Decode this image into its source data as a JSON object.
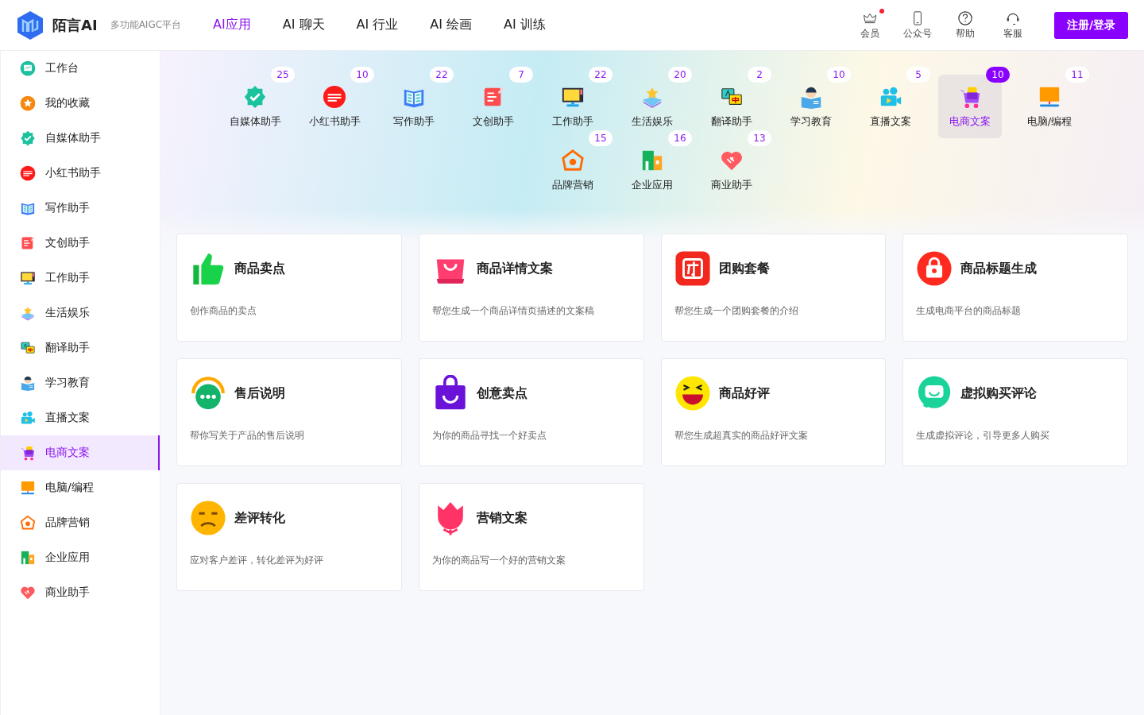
{
  "header": {
    "brand": "陌言AI",
    "tagline": "多功能AIGC平台",
    "nav": [
      {
        "label": "AI应用",
        "selected": true
      },
      {
        "label": "AI 聊天",
        "selected": false
      },
      {
        "label": "AI 行业",
        "selected": false
      },
      {
        "label": "AI 绘画",
        "selected": false
      },
      {
        "label": "AI 训练",
        "selected": false
      }
    ],
    "tools": [
      {
        "kind": "crown",
        "label": "会员",
        "dot": true
      },
      {
        "kind": "phone",
        "label": "公众号",
        "dot": false
      },
      {
        "kind": "help",
        "label": "帮助",
        "dot": false
      },
      {
        "kind": "headset",
        "label": "客服",
        "dot": false
      }
    ],
    "login_button": "注册/登录"
  },
  "sidebar": {
    "items": [
      {
        "kind": "dashboard",
        "label": "工作台",
        "selected": false
      },
      {
        "kind": "favorite",
        "label": "我的收藏",
        "selected": false
      },
      {
        "kind": "verified",
        "label": "自媒体助手",
        "selected": false
      },
      {
        "kind": "xhs",
        "label": "小红书助手",
        "selected": false
      },
      {
        "kind": "book",
        "label": "写作助手",
        "selected": false
      },
      {
        "kind": "note",
        "label": "文创助手",
        "selected": false
      },
      {
        "kind": "monitor",
        "label": "工作助手",
        "selected": false
      },
      {
        "kind": "starbook",
        "label": "生活娱乐",
        "selected": false
      },
      {
        "kind": "translate",
        "label": "翻译助手",
        "selected": false
      },
      {
        "kind": "student",
        "label": "学习教育",
        "selected": false
      },
      {
        "kind": "camera",
        "label": "直播文案",
        "selected": false
      },
      {
        "kind": "cart",
        "label": "电商文案",
        "selected": true
      },
      {
        "kind": "computer",
        "label": "电脑/编程",
        "selected": false
      },
      {
        "kind": "moneyhouse",
        "label": "品牌营销",
        "selected": false
      },
      {
        "kind": "building",
        "label": "企业应用",
        "selected": false
      },
      {
        "kind": "handshake",
        "label": "商业助手",
        "selected": false
      }
    ]
  },
  "categories": [
    {
      "kind": "verified",
      "label": "自媒体助手",
      "count": "25",
      "selected": false
    },
    {
      "kind": "xhs",
      "label": "小红书助手",
      "count": "10",
      "selected": false
    },
    {
      "kind": "book",
      "label": "写作助手",
      "count": "22",
      "selected": false
    },
    {
      "kind": "note",
      "label": "文创助手",
      "count": "7",
      "selected": false
    },
    {
      "kind": "monitor",
      "label": "工作助手",
      "count": "22",
      "selected": false
    },
    {
      "kind": "starbook",
      "label": "生活娱乐",
      "count": "20",
      "selected": false
    },
    {
      "kind": "translate",
      "label": "翻译助手",
      "count": "2",
      "selected": false
    },
    {
      "kind": "student",
      "label": "学习教育",
      "count": "10",
      "selected": false
    },
    {
      "kind": "camera",
      "label": "直播文案",
      "count": "5",
      "selected": false
    },
    {
      "kind": "cart",
      "label": "电商文案",
      "count": "10",
      "selected": true
    },
    {
      "kind": "computer",
      "label": "电脑/编程",
      "count": "11",
      "selected": false
    },
    {
      "kind": "moneyhouse",
      "label": "品牌营销",
      "count": "15",
      "selected": false
    },
    {
      "kind": "building",
      "label": "企业应用",
      "count": "16",
      "selected": false
    },
    {
      "kind": "handshake",
      "label": "商业助手",
      "count": "13",
      "selected": false
    }
  ],
  "apps": [
    {
      "kind": "thumb",
      "title": "商品卖点",
      "description": "创作商品的卖点"
    },
    {
      "kind": "bag",
      "title": "商品详情文案",
      "description": "帮您生成一个商品详情页描述的文案稿"
    },
    {
      "kind": "group",
      "title": "团购套餐",
      "description": "帮您生成一个团购套餐的介绍"
    },
    {
      "kind": "lockbag",
      "title": "商品标题生成",
      "description": "生成电商平台的商品标题"
    },
    {
      "kind": "chatheadset",
      "title": "售后说明",
      "description": "帮你写关于产品的售后说明"
    },
    {
      "kind": "purplebag",
      "title": "创意卖点",
      "description": "为你的商品寻找一个好卖点"
    },
    {
      "kind": "laugh",
      "title": "商品好评",
      "description": "帮您生成超真实的商品好评文案"
    },
    {
      "kind": "chat",
      "title": "虚拟购买评论",
      "description": "生成虚拟评论，引导更多人购买"
    },
    {
      "kind": "sad",
      "title": "差评转化",
      "description": "应对客户差评，转化差评为好评"
    },
    {
      "kind": "tulip",
      "title": "营销文案",
      "description": "为你的商品写一个好的营销文案"
    }
  ]
}
